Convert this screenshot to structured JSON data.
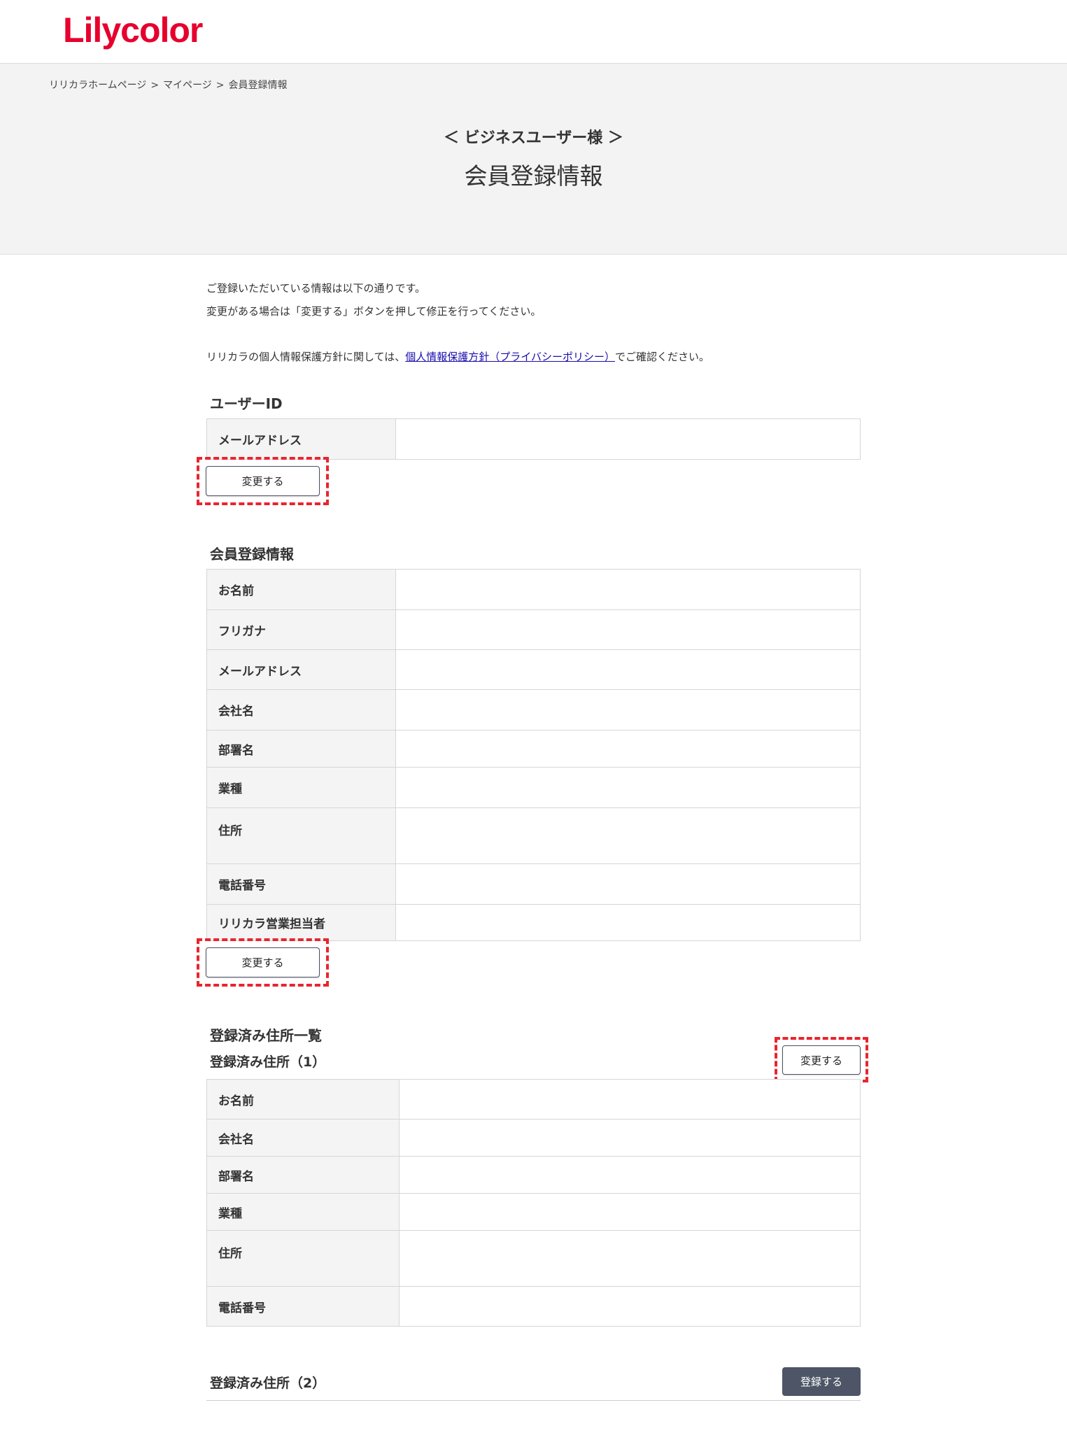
{
  "header": {
    "logo_text": "Lilycolor",
    "brand_color": "#e6002d"
  },
  "breadcrumb": {
    "items": [
      "リリカラホームページ",
      "マイページ",
      "会員登録情報"
    ],
    "separator": ">"
  },
  "hero": {
    "subtitle": "＜ ビジネスユーザー様 ＞",
    "title": "会員登録情報"
  },
  "intro": {
    "line1": "ご登録いただいている情報は以下の通りです。",
    "line2": "変更がある場合は「変更する」ボタンを押して修正を行ってください。",
    "line3_before": "リリカラの個人情報保護方針に関しては、",
    "line3_link": "個人情報保護方針（プライバシーポリシー）",
    "line3_after": "でご確認ください。"
  },
  "user_id_section": {
    "title": "ユーザーID",
    "rows": [
      {
        "label": "メールアドレス",
        "value": ""
      }
    ],
    "change_button": "変更する"
  },
  "member_section": {
    "title": "会員登録情報",
    "rows": [
      {
        "label": "お名前",
        "value": ""
      },
      {
        "label": "フリガナ",
        "value": ""
      },
      {
        "label": "メールアドレス",
        "value": ""
      },
      {
        "label": "会社名",
        "value": ""
      },
      {
        "label": "部署名",
        "value": ""
      },
      {
        "label": "業種",
        "value": ""
      },
      {
        "label": "住所",
        "value": ""
      },
      {
        "label": "電話番号",
        "value": ""
      },
      {
        "label": "リリカラ営業担当者",
        "value": ""
      }
    ],
    "change_button": "変更する"
  },
  "address_section": {
    "title": "登録済み住所一覧",
    "address1": {
      "title": "登録済み住所（1）",
      "change_button": "変更する",
      "rows": [
        {
          "label": "お名前",
          "value": ""
        },
        {
          "label": "会社名",
          "value": ""
        },
        {
          "label": "部署名",
          "value": ""
        },
        {
          "label": "業種",
          "value": ""
        },
        {
          "label": "住所",
          "value": ""
        },
        {
          "label": "電話番号",
          "value": ""
        }
      ]
    },
    "address2": {
      "title": "登録済み住所（2）",
      "register_button": "登録する"
    }
  },
  "colors": {
    "highlight_dash": "#e8252e",
    "dark_button": "#4d5566",
    "link": "#1a0dab"
  }
}
